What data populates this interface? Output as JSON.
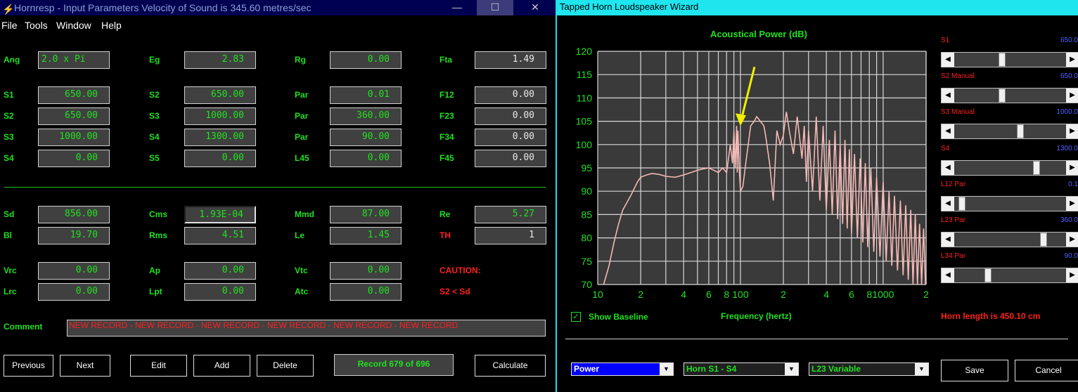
{
  "left_window": {
    "title": "Hornresp - Input Parameters   Velocity of Sound is 345.60 metres/sec",
    "controls": {
      "minimize": "—",
      "maximize": "☐",
      "close": "✕"
    },
    "menu": [
      "File",
      "Tools",
      "Window",
      "Help"
    ],
    "params": {
      "ang": {
        "label": "Ang",
        "value": "2.0 x Pi"
      },
      "eg": {
        "label": "Eg",
        "value": "2.83"
      },
      "rg": {
        "label": "Rg",
        "value": "0.00"
      },
      "fta": {
        "label": "Fta",
        "value": "1.49"
      },
      "s1": {
        "label": "S1",
        "value": "650.00"
      },
      "s2b": {
        "label": "S2",
        "value": "650.00"
      },
      "par1": {
        "label": "Par",
        "value": "0.01"
      },
      "f12": {
        "label": "F12",
        "value": "0.00"
      },
      "s2": {
        "label": "S2",
        "value": "650.00"
      },
      "s3b": {
        "label": "S3",
        "value": "1000.00"
      },
      "par2": {
        "label": "Par",
        "value": "360.00"
      },
      "f23": {
        "label": "F23",
        "value": "0.00"
      },
      "s3": {
        "label": "S3",
        "value": "1000.00"
      },
      "s4b": {
        "label": "S4",
        "value": "1300.00"
      },
      "par3": {
        "label": "Par",
        "value": "90.00"
      },
      "f34": {
        "label": "F34",
        "value": "0.00"
      },
      "s4": {
        "label": "S4",
        "value": "0.00"
      },
      "s5": {
        "label": "S5",
        "value": "0.00"
      },
      "l45": {
        "label": "L45",
        "value": "0.00"
      },
      "f45": {
        "label": "F45",
        "value": "0.00"
      },
      "sd": {
        "label": "Sd",
        "value": "856.00"
      },
      "cms": {
        "label": "Cms",
        "value": "1.93E-04"
      },
      "mmd": {
        "label": "Mmd",
        "value": "87.00"
      },
      "re": {
        "label": "Re",
        "value": "5.27"
      },
      "bl": {
        "label": "Bl",
        "value": "19.70"
      },
      "rms": {
        "label": "Rms",
        "value": "4.51"
      },
      "le": {
        "label": "Le",
        "value": "1.45"
      },
      "th": {
        "label": "TH",
        "value": "1"
      },
      "vrc": {
        "label": "Vrc",
        "value": "0.00"
      },
      "ap": {
        "label": "Ap",
        "value": "0.00"
      },
      "vtc": {
        "label": "Vtc",
        "value": "0.00"
      },
      "lrc": {
        "label": "Lrc",
        "value": "0.00"
      },
      "lpt": {
        "label": "Lpt",
        "value": "0.00"
      },
      "atc": {
        "label": "Atc",
        "value": "0.00"
      }
    },
    "caution": "CAUTION:",
    "caution_detail": "S2 < Sd",
    "comment_label": "Comment",
    "comment_value": "NEW RECORD - NEW RECORD - NEW RECORD - NEW RECORD - NEW RECORD - NEW RECORD",
    "buttons": {
      "previous": "Previous",
      "next": "Next",
      "edit": "Edit",
      "add": "Add",
      "delete": "Delete",
      "record": "Record 679 of 696",
      "calculate": "Calculate"
    }
  },
  "right_window": {
    "title": "Tapped Horn Loudspeaker Wizard",
    "show_baseline": "Show Baseline",
    "show_baseline_checked": true,
    "horn_length": "Horn length is 450.10 cm",
    "sliders": [
      {
        "label": "S1",
        "value": "650.0",
        "position": 0.42
      },
      {
        "label": "S2  Manual",
        "value": "650.0",
        "position": 0.42
      },
      {
        "label": "S3  Manual",
        "value": "1000.0",
        "position": 0.6
      },
      {
        "label": "S4",
        "value": "1300.0",
        "position": 0.75
      },
      {
        "label": "L12  Par",
        "value": "0.1",
        "position": 0.04
      },
      {
        "label": "L23  Par",
        "value": "360.0",
        "position": 0.82
      },
      {
        "label": "L34  Par",
        "value": "90.0",
        "position": 0.29
      }
    ],
    "dropdowns": {
      "power": "Power",
      "horn": "Horn S1 - S4",
      "variable": "L23 Variable"
    },
    "buttons": {
      "save": "Save",
      "cancel": "Cancel"
    },
    "colors": {
      "curve": "#f4b8b4",
      "grid": "#d8d8d8",
      "arrow": "#f0f000",
      "plot_bg": "#3a3a3a"
    }
  },
  "chart_data": {
    "type": "line",
    "title": "Acoustical Power (dB)",
    "xlabel": "Frequency (hertz)",
    "ylabel": "",
    "x_scale": "log",
    "xlim": [
      10,
      2000
    ],
    "ylim": [
      70,
      120
    ],
    "x_tick_labels": [
      "10",
      "2",
      "4",
      "6",
      "8",
      "100",
      "2",
      "4",
      "6",
      "8",
      "1000",
      "2"
    ],
    "y_ticks": [
      120,
      115,
      110,
      105,
      100,
      95,
      90,
      85,
      80,
      75,
      70
    ],
    "annotation": {
      "type": "arrow",
      "x": 100,
      "y": 104
    },
    "series": [
      {
        "x": [
          11,
          12,
          13,
          14,
          15,
          17,
          19,
          20,
          22,
          24,
          27,
          30,
          35,
          40,
          45,
          50,
          55,
          60,
          65,
          70,
          75,
          80,
          85,
          88,
          90,
          92,
          94,
          95,
          96,
          98,
          100,
          104,
          110,
          118,
          125,
          130,
          138,
          146,
          150,
          160,
          170,
          180,
          190,
          200,
          210,
          220,
          235,
          250,
          270,
          280,
          290,
          300,
          320,
          340,
          360,
          380,
          400,
          420,
          440,
          460,
          480,
          500,
          520,
          540,
          560,
          580,
          600,
          630,
          660,
          690,
          720,
          750,
          780,
          820,
          860,
          900,
          950,
          1000,
          1050,
          1100,
          1150,
          1200,
          1260,
          1320,
          1380,
          1440,
          1500,
          1560,
          1620,
          1680,
          1740,
          1800,
          1860,
          1920,
          1980
        ],
        "y": [
          70,
          74,
          79,
          83,
          86,
          89,
          92,
          93,
          93.5,
          93.8,
          93.6,
          93.2,
          93,
          93.5,
          94,
          94.5,
          94.8,
          95,
          94.5,
          94,
          95,
          94,
          100,
          96,
          103,
          95,
          104,
          94,
          103,
          95,
          90,
          91,
          97,
          104,
          105,
          106,
          105,
          104,
          102,
          96,
          88,
          103,
          100,
          102,
          107,
          103,
          98,
          106,
          97,
          104,
          92,
          103,
          90,
          106,
          88,
          104,
          86,
          101,
          85,
          103,
          84,
          100,
          83,
          101,
          82,
          99,
          81,
          98,
          80,
          97,
          79,
          96,
          78,
          95,
          77,
          93,
          76,
          92,
          75,
          90,
          74,
          89,
          73,
          88,
          72,
          87,
          71,
          86,
          70,
          85,
          70,
          83,
          70,
          82,
          70
        ]
      }
    ]
  }
}
